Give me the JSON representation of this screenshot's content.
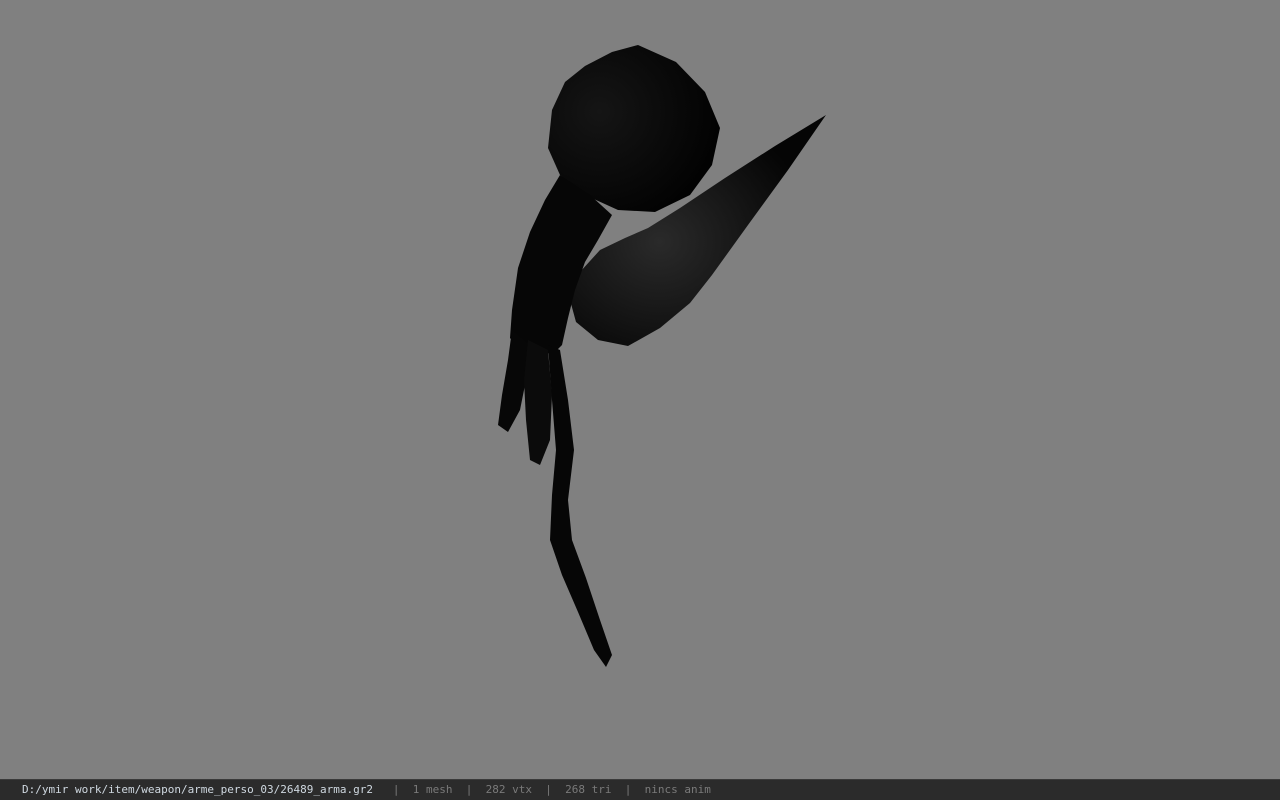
{
  "viewport": {
    "model": "weapon mesh",
    "background_color": "#808080",
    "mesh_color": "#0a0a0a"
  },
  "status_bar": {
    "file_path": "D:/ymir work/item/weapon/arme_perso_03/26489_arma.gr2",
    "separator": "|",
    "mesh_count": "1 mesh",
    "vertex_count": "282 vtx",
    "triangle_count": "268 tri",
    "animation": "nincs anim"
  }
}
